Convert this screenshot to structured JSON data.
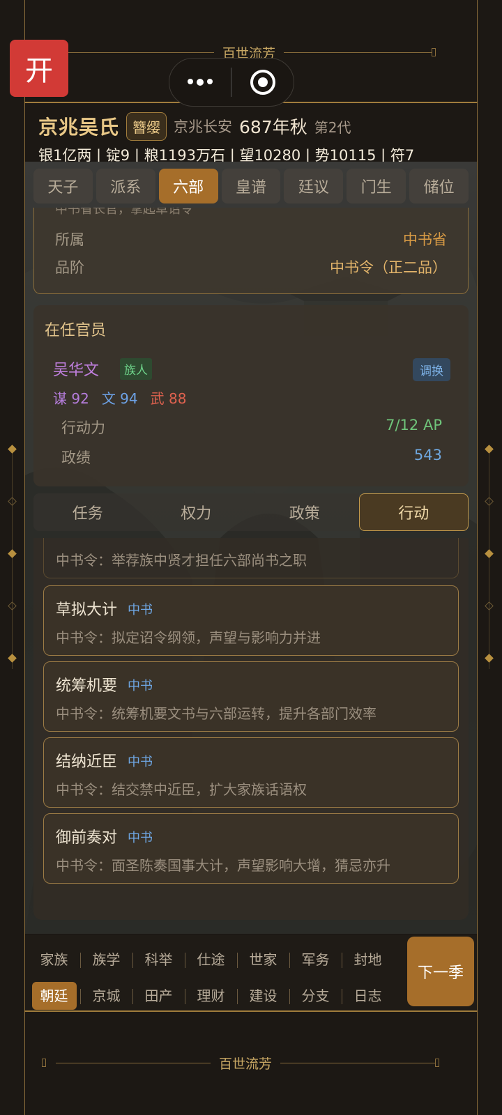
{
  "frame": {
    "title_top": "百世流芳",
    "title_bottom": "百世流芳"
  },
  "open_button": "开",
  "family": {
    "name": "京兆吴氏",
    "badge": "簪缨",
    "location": "京兆长安",
    "year": "687年秋",
    "generation": "第2代",
    "resources": "银1亿两 | 锭9 | 粮1193万石 | 望10280 | 势10115 | 符7"
  },
  "top_tabs": [
    "天子",
    "派系",
    "六部",
    "皇谱",
    "廷议",
    "门生",
    "储位"
  ],
  "top_tab_active": "六部",
  "office_info": {
    "cut_text": "中书省长官，掌起草诏令",
    "rows": [
      {
        "label": "所属",
        "value": "中书省"
      },
      {
        "label": "品阶",
        "value": "中书令（正二品）"
      }
    ]
  },
  "official": {
    "section_title": "在任官员",
    "name": "吴华文",
    "tag": "族人",
    "swap_label": "调换",
    "stats": [
      "谋 92",
      "文 94",
      "武 88"
    ],
    "action_points_label": "行动力",
    "action_points_value": "7/12 AP",
    "merit_label": "政绩",
    "merit_value": "543"
  },
  "sub_tabs": [
    "任务",
    "权力",
    "政策",
    "行动"
  ],
  "sub_tab_active": "行动",
  "actions_partial": "中书令：举荐族中贤才担任六部尚书之职",
  "actions": [
    {
      "name": "草拟大计",
      "dept": "中书",
      "desc": "中书令：拟定诏令纲领，声望与影响力并进"
    },
    {
      "name": "统筹机要",
      "dept": "中书",
      "desc": "中书令：统筹机要文书与六部运转，提升各部门效率"
    },
    {
      "name": "结纳近臣",
      "dept": "中书",
      "desc": "中书令：结交禁中近臣，扩大家族话语权"
    },
    {
      "name": "御前奏对",
      "dept": "中书",
      "desc": "中书令：面圣陈奏国事大计，声望影响大增，猜忌亦升"
    }
  ],
  "bottom_nav": {
    "row1": [
      "家族",
      "族学",
      "科举",
      "仕途",
      "世家",
      "军务",
      "封地"
    ],
    "row2": [
      "朝廷",
      "京城",
      "田产",
      "理财",
      "建设",
      "分支",
      "日志"
    ],
    "active": "朝廷",
    "next_label": "下一季"
  }
}
